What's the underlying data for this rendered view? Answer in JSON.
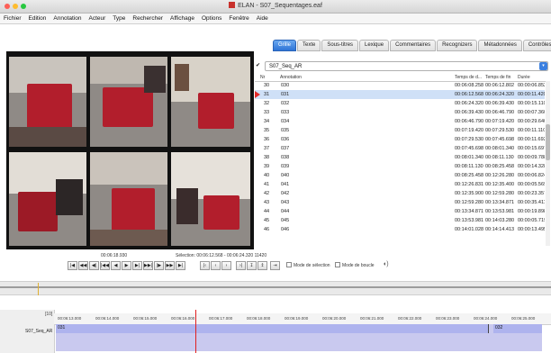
{
  "window": {
    "title": "ELAN - S07_Sequentages.eaf",
    "traffic_colors": [
      "#fd5f57",
      "#febc2e",
      "#28c840"
    ]
  },
  "menu": [
    "Fichier",
    "Edition",
    "Annotation",
    "Acteur",
    "Type",
    "Rechercher",
    "Affichage",
    "Options",
    "Fenêtre",
    "Aide"
  ],
  "tabs": [
    "Grille",
    "Texte",
    "Sous-titres",
    "Lexique",
    "Commentaires",
    "Recognizers",
    "Métadonnées",
    "Contrôles"
  ],
  "active_tab": 0,
  "tier_select": {
    "value": "S07_Seq_AR"
  },
  "table": {
    "columns": [
      "Nr",
      "Annotation",
      "Temps de d...",
      "Temps de fin",
      "Durée"
    ],
    "rows": [
      {
        "nr": "30",
        "ann": "030",
        "start": "00:06:08.258",
        "end": "00:06:12.802",
        "dur": "00:00:06.852"
      },
      {
        "nr": "31",
        "ann": "031",
        "start": "00:06:12.568",
        "end": "00:06:24.320",
        "dur": "00:00:11.420"
      },
      {
        "nr": "32",
        "ann": "032",
        "start": "00:06:24.320",
        "end": "00:06:39.430",
        "dur": "00:00:15.110"
      },
      {
        "nr": "33",
        "ann": "033",
        "start": "00:06:39.430",
        "end": "00:06:46.790",
        "dur": "00:00:07.360"
      },
      {
        "nr": "34",
        "ann": "034",
        "start": "00:06:46.790",
        "end": "00:07:19.420",
        "dur": "00:00:29.640"
      },
      {
        "nr": "35",
        "ann": "035",
        "start": "00:07:19.420",
        "end": "00:07:29.530",
        "dur": "00:00:11.110"
      },
      {
        "nr": "36",
        "ann": "036",
        "start": "00:07:29.530",
        "end": "00:07:45.698",
        "dur": "00:00:11.692"
      },
      {
        "nr": "37",
        "ann": "037",
        "start": "00:07:45.698",
        "end": "00:08:01.340",
        "dur": "00:00:15.697"
      },
      {
        "nr": "38",
        "ann": "038",
        "start": "00:08:01.340",
        "end": "00:08:11.130",
        "dur": "00:00:09.788"
      },
      {
        "nr": "39",
        "ann": "039",
        "start": "00:08:11.130",
        "end": "00:08:25.458",
        "dur": "00:00:14.328"
      },
      {
        "nr": "40",
        "ann": "040",
        "start": "00:08:25.458",
        "end": "00:12:26.280",
        "dur": "00:00:06.824"
      },
      {
        "nr": "41",
        "ann": "041",
        "start": "00:12:26.831",
        "end": "00:12:35.400",
        "dur": "00:00:05.569"
      },
      {
        "nr": "42",
        "ann": "042",
        "start": "00:12:35.900",
        "end": "00:12:59.280",
        "dur": "00:00:23.357"
      },
      {
        "nr": "43",
        "ann": "043",
        "start": "00:12:59.280",
        "end": "00:13:34.871",
        "dur": "00:00:35.411"
      },
      {
        "nr": "44",
        "ann": "044",
        "start": "00:13:34.871",
        "end": "00:13:53.981",
        "dur": "00:00:19.898"
      },
      {
        "nr": "45",
        "ann": "045",
        "start": "00:13:53.981",
        "end": "00:14:03.280",
        "dur": "00:00:05.719"
      },
      {
        "nr": "46",
        "ann": "046",
        "start": "00:14:01.028",
        "end": "00:14:14.413",
        "dur": "00:00:13.495"
      }
    ],
    "selected_row": 1
  },
  "player": {
    "timecode": "00:06:18.930",
    "selection": "Sélection: 00:06:12.568 - 00:06:24.320 11420",
    "buttons": [
      "|◀",
      "◀◀",
      "◀|",
      "|◀◀",
      "◀",
      "▶",
      "▶|",
      "▶▶|",
      "|▶",
      "▶▶",
      "▶|"
    ],
    "buttons2": [
      "|‹",
      "‹",
      "›",
      "›|",
      "↧",
      "↥",
      "⇥"
    ],
    "chk1": "Mode de sélection",
    "chk2": "Mode de boucle"
  },
  "timeline": {
    "ticks": [
      "00:06:13.000",
      "00:06:14.000",
      "00:06:15.000",
      "00:06:16.000",
      "00:06:17.000",
      "00:06:18.000",
      "00:06:19.000",
      "00:06:20.000",
      "00:06:21.000",
      "00:06:22.000",
      "00:06:23.000",
      "00:06:24.000",
      "00:06:25.000"
    ],
    "tier_label": "S07_Seq_AR",
    "seg1": "031",
    "seg2": "032",
    "counter": "[10]"
  }
}
